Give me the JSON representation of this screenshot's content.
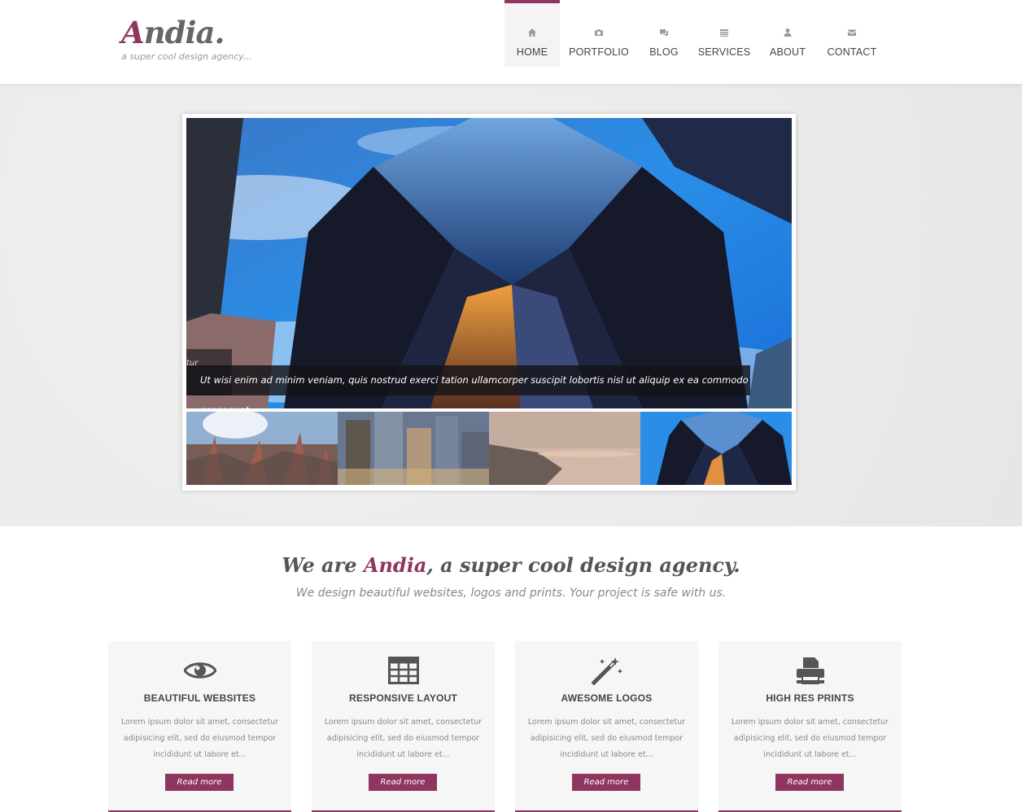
{
  "brand": {
    "logo_initial": "A",
    "logo_rest": "ndia.",
    "tagline": "a super cool design agency...",
    "accent_color": "#8e3560"
  },
  "nav": {
    "items": [
      {
        "label": "HOME",
        "icon": "home-icon",
        "active": true
      },
      {
        "label": "PORTFOLIO",
        "icon": "camera-icon",
        "active": false
      },
      {
        "label": "BLOG",
        "icon": "comments-icon",
        "active": false
      },
      {
        "label": "SERVICES",
        "icon": "list-icon",
        "active": false
      },
      {
        "label": "ABOUT",
        "icon": "user-icon",
        "active": false
      },
      {
        "label": "CONTACT",
        "icon": "envelope-icon",
        "active": false
      }
    ]
  },
  "slider": {
    "caption": "Ut wisi enim ad minim veniam, quis nostrud exerci tation ullamcorper suscipit lobortis nisl ut aliquip ex ea commodo consequat.",
    "caption_ghost": "tur",
    "thumbnails": [
      "autumn-plants",
      "city-skyscrapers",
      "sunset-coast",
      "glass-tower"
    ]
  },
  "intro": {
    "title_before": "We are ",
    "title_accent": "Andia",
    "title_after": ", a super cool design agency.",
    "subtitle": "We design beautiful websites, logos and prints. Your project is safe with us."
  },
  "features": [
    {
      "icon": "eye-icon",
      "title": "BEAUTIFUL WEBSITES",
      "text": "Lorem ipsum dolor sit amet, consectetur adipisicing elit, sed do eiusmod tempor incididunt ut labore et...",
      "button": "Read more"
    },
    {
      "icon": "table-icon",
      "title": "RESPONSIVE LAYOUT",
      "text": "Lorem ipsum dolor sit amet, consectetur adipisicing elit, sed do eiusmod tempor incididunt ut labore et...",
      "button": "Read more"
    },
    {
      "icon": "magic-wand-icon",
      "title": "AWESOME LOGOS",
      "text": "Lorem ipsum dolor sit amet, consectetur adipisicing elit, sed do eiusmod tempor incididunt ut labore et...",
      "button": "Read more"
    },
    {
      "icon": "printer-icon",
      "title": "HIGH RES PRINTS",
      "text": "Lorem ipsum dolor sit amet, consectetur adipisicing elit, sed do eiusmod tempor incididunt ut labore et...",
      "button": "Read more"
    }
  ]
}
